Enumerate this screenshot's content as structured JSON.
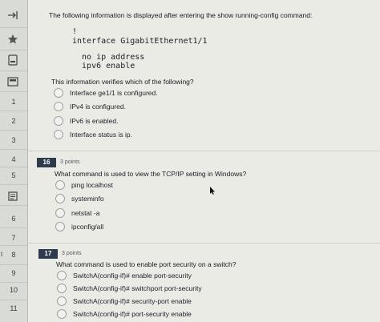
{
  "sidebar": {
    "items": [
      "1",
      "2",
      "3",
      "4",
      "5",
      "6",
      "7",
      "8",
      "9",
      "10",
      "11"
    ],
    "edge_marker": "t"
  },
  "question15": {
    "intro": "The following information is displayed after entering the show running-config command:",
    "code": [
      "!",
      "interface GigabitEthernet1/1",
      "  no ip address",
      "  ipv6 enable"
    ],
    "prompt": "This information verifies which of the following?",
    "options": [
      "Interface ge1/1 is configured.",
      "IPv4 is configured.",
      "IPv6 is enabled.",
      "Interface status is ip."
    ]
  },
  "question16": {
    "number": "16",
    "points": "3 points",
    "prompt": "What command is used to view the TCP/IP setting in Windows?",
    "options": [
      "ping localhost",
      "systeminfo",
      "netstat -a",
      "ipconfig/all"
    ]
  },
  "question17": {
    "number": "17",
    "points": "3 points",
    "prompt": "What command is used to enable port security on a switch?",
    "options": [
      "SwitchA(config-if)# enable port-security",
      "SwitchA(config-if)# switchport port-security",
      "SwitchA(config-if)# security-port enable",
      "SwitchA(config-if)# port-security enable"
    ]
  }
}
